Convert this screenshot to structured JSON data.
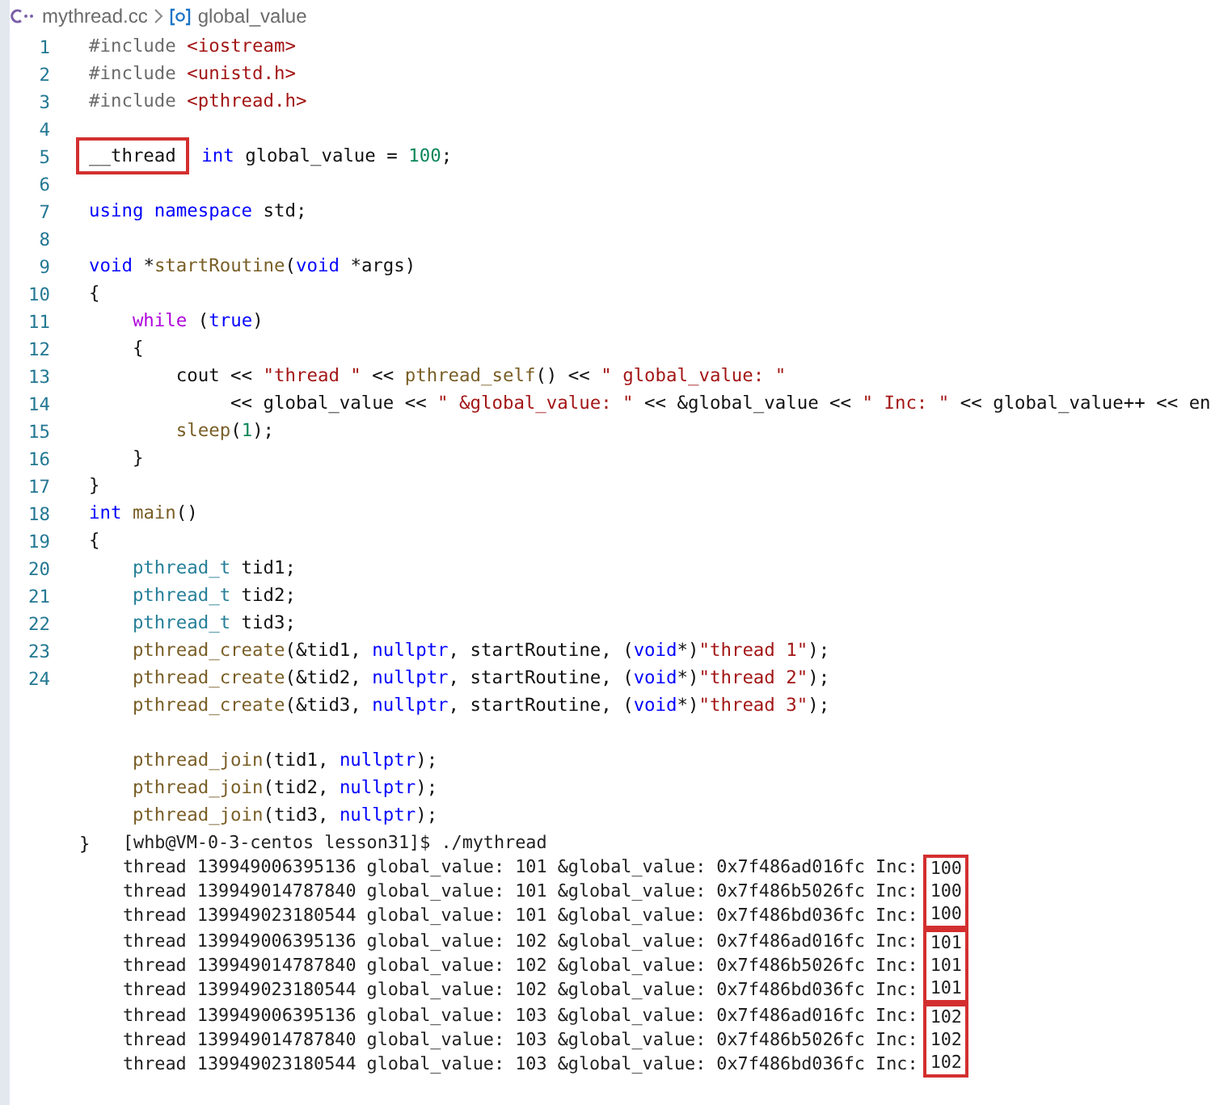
{
  "breadcrumb": {
    "file": "mythread.cc",
    "symbol": "global_value"
  },
  "code": {
    "lines": [
      {
        "number": "1",
        "tokens": [
          {
            "kind": "pp",
            "text": "#include"
          },
          {
            "kind": "inc",
            "text": " <iostream>"
          }
        ]
      },
      {
        "number": "2",
        "tokens": [
          {
            "kind": "pp",
            "text": "#include"
          },
          {
            "kind": "inc",
            "text": " <unistd.h>"
          }
        ]
      },
      {
        "number": "3",
        "tokens": [
          {
            "kind": "pp",
            "text": "#include"
          },
          {
            "kind": "inc",
            "text": " <pthread.h>"
          }
        ]
      },
      {
        "number": "4"
      },
      {
        "number": "5",
        "tokens": [
          {
            "kind": "plain",
            "text": "__thread",
            "boxed": true
          },
          {
            "kind": "kw",
            "text": " int"
          },
          {
            "kind": "plain",
            "text": " global_value = "
          },
          {
            "kind": "num",
            "text": "100"
          },
          {
            "kind": "plain",
            "text": ";"
          }
        ]
      },
      {
        "number": "6"
      },
      {
        "number": "7",
        "tokens": [
          {
            "kind": "kw",
            "text": "using"
          },
          {
            "kind": "kw",
            "text": " namespace"
          },
          {
            "kind": "plain",
            "text": " std;"
          }
        ]
      },
      {
        "number": "8"
      },
      {
        "number": "9",
        "tokens": [
          {
            "kind": "kw",
            "text": "void"
          },
          {
            "kind": "plain",
            "text": " *"
          },
          {
            "kind": "fn",
            "text": "startRoutine"
          },
          {
            "kind": "plain",
            "text": "("
          },
          {
            "kind": "kw",
            "text": "void"
          },
          {
            "kind": "plain",
            "text": " *args)"
          }
        ]
      },
      {
        "number": "10",
        "tokens": [
          {
            "kind": "plain",
            "text": "{"
          }
        ]
      },
      {
        "number": "11",
        "tokens": [
          {
            "kind": "ctrl",
            "text": "    while"
          },
          {
            "kind": "plain",
            "text": " ("
          },
          {
            "kind": "kw",
            "text": "true"
          },
          {
            "kind": "plain",
            "text": ")"
          }
        ]
      },
      {
        "number": "12",
        "tokens": [
          {
            "kind": "plain",
            "text": "    {"
          }
        ]
      },
      {
        "number": "13",
        "tokens": [
          {
            "kind": "plain",
            "text": "        cout << "
          },
          {
            "kind": "str",
            "text": "\"thread \""
          },
          {
            "kind": "plain",
            "text": " << "
          },
          {
            "kind": "fn",
            "text": "pthread_self"
          },
          {
            "kind": "plain",
            "text": "() << "
          },
          {
            "kind": "str",
            "text": "\" global_value: \""
          }
        ]
      },
      {
        "number": "14",
        "tokens": [
          {
            "kind": "plain",
            "text": "             << global_value << "
          },
          {
            "kind": "str",
            "text": "\" &global_value: \""
          },
          {
            "kind": "plain",
            "text": " << &global_value << "
          },
          {
            "kind": "str",
            "text": "\" Inc: \""
          },
          {
            "kind": "plain",
            "text": " << global_value++ << en"
          }
        ]
      },
      {
        "number": "15",
        "tokens": [
          {
            "kind": "fn",
            "text": "        sleep"
          },
          {
            "kind": "plain",
            "text": "("
          },
          {
            "kind": "num",
            "text": "1"
          },
          {
            "kind": "plain",
            "text": ");"
          }
        ]
      },
      {
        "number": "16",
        "tokens": [
          {
            "kind": "plain",
            "text": "    }"
          }
        ]
      },
      {
        "number": "17",
        "tokens": [
          {
            "kind": "plain",
            "text": "}"
          }
        ]
      },
      {
        "number": "18",
        "tokens": [
          {
            "kind": "kw",
            "text": "int"
          },
          {
            "kind": "fn",
            "text": " main"
          },
          {
            "kind": "plain",
            "text": "()"
          }
        ]
      },
      {
        "number": "19",
        "tokens": [
          {
            "kind": "plain",
            "text": "{"
          }
        ]
      },
      {
        "number": "20",
        "tokens": [
          {
            "kind": "type",
            "text": "    pthread_t"
          },
          {
            "kind": "plain",
            "text": " tid1;"
          }
        ]
      },
      {
        "number": "21",
        "tokens": [
          {
            "kind": "type",
            "text": "    pthread_t"
          },
          {
            "kind": "plain",
            "text": " tid2;"
          }
        ]
      },
      {
        "number": "22",
        "tokens": [
          {
            "kind": "type",
            "text": "    pthread_t"
          },
          {
            "kind": "plain",
            "text": " tid3;"
          }
        ]
      },
      {
        "number": "23",
        "tokens": [
          {
            "kind": "fn",
            "text": "    pthread_create"
          },
          {
            "kind": "plain",
            "text": "(&tid1, "
          },
          {
            "kind": "kw",
            "text": "nullptr"
          },
          {
            "kind": "plain",
            "text": ", startRoutine, ("
          },
          {
            "kind": "kw",
            "text": "void"
          },
          {
            "kind": "plain",
            "text": "*)"
          },
          {
            "kind": "str",
            "text": "\"thread 1\""
          },
          {
            "kind": "plain",
            "text": ");"
          }
        ]
      },
      {
        "number": "24",
        "tokens": [
          {
            "kind": "fn",
            "text": "    pthread_create"
          },
          {
            "kind": "plain",
            "text": "(&tid2, "
          },
          {
            "kind": "kw",
            "text": "nullptr"
          },
          {
            "kind": "plain",
            "text": ", startRoutine, ("
          },
          {
            "kind": "kw",
            "text": "void"
          },
          {
            "kind": "plain",
            "text": "*)"
          },
          {
            "kind": "str",
            "text": "\"thread 2\""
          },
          {
            "kind": "plain",
            "text": ");"
          }
        ]
      },
      {
        "tokens": [
          {
            "kind": "fn",
            "text": "    pthread_create"
          },
          {
            "kind": "plain",
            "text": "(&tid3, "
          },
          {
            "kind": "kw",
            "text": "nullptr"
          },
          {
            "kind": "plain",
            "text": ", startRoutine, ("
          },
          {
            "kind": "kw",
            "text": "void"
          },
          {
            "kind": "plain",
            "text": "*)"
          },
          {
            "kind": "str",
            "text": "\"thread 3\""
          },
          {
            "kind": "plain",
            "text": ");"
          }
        ]
      },
      {
        "kind": "blank"
      },
      {
        "tokens": [
          {
            "kind": "fn",
            "text": "    pthread_join"
          },
          {
            "kind": "plain",
            "text": "(tid1, "
          },
          {
            "kind": "kw",
            "text": "nullptr"
          },
          {
            "kind": "plain",
            "text": ");"
          }
        ]
      },
      {
        "tokens": [
          {
            "kind": "fn",
            "text": "    pthread_join"
          },
          {
            "kind": "plain",
            "text": "(tid2, "
          },
          {
            "kind": "kw",
            "text": "nullptr"
          },
          {
            "kind": "plain",
            "text": ");"
          }
        ]
      },
      {
        "tokens": [
          {
            "kind": "fn",
            "text": "    pthread_join"
          },
          {
            "kind": "plain",
            "text": "(tid3, "
          },
          {
            "kind": "kw",
            "text": "nullptr"
          },
          {
            "kind": "plain",
            "text": ");"
          }
        ]
      },
      {
        "tokens": [
          {
            "kind": "plain",
            "text": "}"
          }
        ]
      }
    ]
  },
  "terminal": {
    "prompt": "[whb@VM-0-3-centos lesson31]$ ./mythread",
    "groups": [
      {
        "rows": [
          {
            "text": "thread 139949006395136 global_value: 101 &global_value: 0x7f486ad016fc Inc: ",
            "inc": "100"
          },
          {
            "text": "thread 139949014787840 global_value: 101 &global_value: 0x7f486b5026fc Inc: ",
            "inc": "100"
          },
          {
            "text": "thread 139949023180544 global_value: 101 &global_value: 0x7f486bd036fc Inc: ",
            "inc": "100"
          }
        ]
      },
      {
        "rows": [
          {
            "text": "thread 139949006395136 global_value: 102 &global_value: 0x7f486ad016fc Inc: ",
            "inc": "101"
          },
          {
            "text": "thread 139949014787840 global_value: 102 &global_value: 0x7f486b5026fc Inc: ",
            "inc": "101"
          },
          {
            "text": "thread 139949023180544 global_value: 102 &global_value: 0x7f486bd036fc Inc: ",
            "inc": "101"
          }
        ]
      },
      {
        "rows": [
          {
            "text": "thread 139949006395136 global_value: 103 &global_value: 0x7f486ad016fc Inc: ",
            "inc": "102"
          },
          {
            "text": "thread 139949014787840 global_value: 103 &global_value: 0x7f486b5026fc Inc: ",
            "inc": "102"
          },
          {
            "text": "thread 139949023180544 global_value: 103 &global_value: 0x7f486bd036fc Inc: ",
            "inc": "102"
          }
        ]
      }
    ]
  }
}
